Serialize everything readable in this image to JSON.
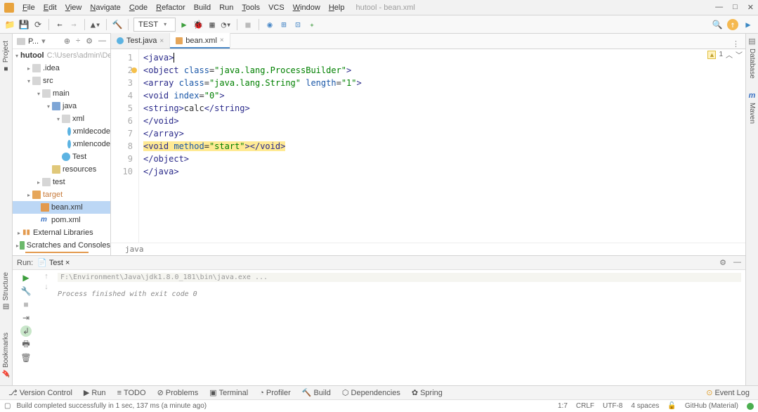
{
  "menu": {
    "file": "File",
    "edit": "Edit",
    "view": "View",
    "navigate": "Navigate",
    "code": "Code",
    "refactor": "Refactor",
    "build": "Build",
    "run": "Run",
    "tools": "Tools",
    "vcs": "VCS",
    "window": "Window",
    "help": "Help",
    "title": "hutool - bean.xml"
  },
  "run_config": "TEST",
  "crumb": {
    "root": "hutool",
    "path_project": "P...",
    "path": "C:\\Users\\admin\\Des"
  },
  "side_left": {
    "project": "Project",
    "structure": "Structure",
    "bookmarks": "Bookmarks"
  },
  "side_right": {
    "database": "Database",
    "maven": "Maven"
  },
  "tree": {
    "root": "hutool",
    "root_path": "C:\\Users\\admin\\Des",
    "idea": ".idea",
    "src": "src",
    "main": "main",
    "java": "java",
    "xml": "xml",
    "xmldecode": "xmldecode",
    "xmlencode": "xmlencode",
    "test_class": "Test",
    "resources": "resources",
    "test": "test",
    "target": "target",
    "bean": "bean.xml",
    "pom": "pom.xml",
    "ext_lib": "External Libraries",
    "scratch": "Scratches and Consoles"
  },
  "tabs": {
    "test": "Test.java",
    "bean": "bean.xml"
  },
  "code": {
    "lines": [
      {
        "n": 1,
        "html": "<span class='tag'>&lt;java&gt;</span><span class='caret'></span>"
      },
      {
        "n": 2,
        "html": "<span class='tag'>&lt;object</span> <span class='attr'>class</span>=<span class='val'>\"java.lang.ProcessBuilder\"</span><span class='tag'>&gt;</span>"
      },
      {
        "n": 3,
        "html": "<span class='tag'>&lt;array</span> <span class='attr'>class</span>=<span class='val'>\"java.lang.String\"</span> <span class='attr'>length</span>=<span class='val'>\"1\"</span><span class='tag'>&gt;</span>"
      },
      {
        "n": 4,
        "html": "<span class='tag'>&lt;void</span> <span class='attr'>index</span>=<span class='val'>\"0\"</span><span class='tag'>&gt;</span>"
      },
      {
        "n": 5,
        "html": "<span class='tag'>&lt;string&gt;</span>calc<span class='tag'>&lt;/string&gt;</span>"
      },
      {
        "n": 6,
        "html": "<span class='tag'>&lt;/void&gt;</span>"
      },
      {
        "n": 7,
        "html": "<span class='tag'>&lt;/array&gt;</span>"
      },
      {
        "n": 8,
        "html": "<span class='hl'><span class='tag'>&lt;void</span> <span class='attr'>method</span>=<span class='val'>\"start\"</span><span class='tag'>&gt;&lt;/void&gt;</span></span>"
      },
      {
        "n": 9,
        "html": "<span class='tag'>&lt;/object&gt;</span>"
      },
      {
        "n": 10,
        "html": "<span class='tag'>&lt;/java&gt;</span>"
      }
    ],
    "breadcrumb": "java",
    "warning_count": "1"
  },
  "run": {
    "label": "Run:",
    "config": "Test",
    "cmd": "F:\\Environment\\Java\\jdk1.8.0_181\\bin\\java.exe ...",
    "exit": "Process finished with exit code 0"
  },
  "bottom": {
    "vcs": "Version Control",
    "run": "Run",
    "todo": "TODO",
    "problems": "Problems",
    "terminal": "Terminal",
    "profiler": "Profiler",
    "build": "Build",
    "deps": "Dependencies",
    "spring": "Spring",
    "event_log": "Event Log"
  },
  "status": {
    "msg": "Build completed successfully in 1 sec, 137 ms (a minute ago)",
    "pos": "1:7",
    "sep": "CRLF",
    "enc": "UTF-8",
    "indent": "4 spaces",
    "branch": "",
    "github": "GitHub (Material)"
  }
}
